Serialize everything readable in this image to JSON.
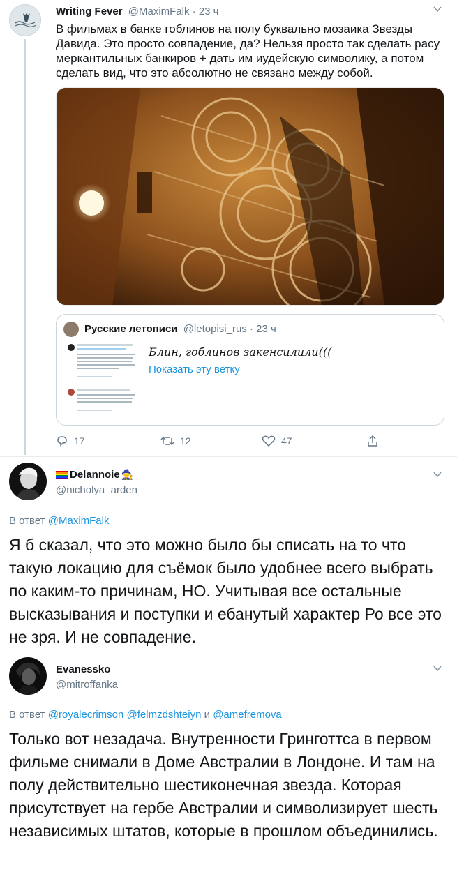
{
  "tweet1": {
    "name": "Writing Fever",
    "handle": "@MaximFalk",
    "time": "· 23 ч",
    "text": "В фильмах в банке гоблинов на полу буквально мозаика Звезды Давида. Это просто совпадение, да? Нельзя просто так сделать расу меркантильных банкиров + дать им иудейскую символику, а потом сделать вид, что это абсолютно не связано между собой.",
    "quote": {
      "name": "Русские летописи",
      "handle": "@letopisi_rus",
      "time": "· 23 ч",
      "text": "Блин, гоблинов закенсилили(((",
      "show_thread": "Показать эту ветку"
    },
    "actions": {
      "replies": "17",
      "retweets": "12",
      "likes": "47"
    }
  },
  "tweet2": {
    "name": "Delannoie",
    "handle": "@nicholya_arden",
    "reply_prefix": "В ответ",
    "reply_to": "@MaximFalk",
    "text": "Я б сказал, что это можно было бы списать на то что такую локацию для съёмок было удобнее всего выбрать по каким-то причинам, НО. Учитывая все остальные высказывания и поступки и ебанутый характер Ро все это не зря. И не совпадение."
  },
  "tweet3": {
    "name": "Evanessko",
    "handle": "@mitroffanka",
    "reply_prefix": "В ответ",
    "reply_to_1": "@royalecrimson",
    "reply_to_2": "@felmzdshteiyn",
    "reply_and": "и",
    "reply_to_3": "@amefremova",
    "text": "Только вот незадача. Внутренности Гринготтса в первом фильме снимали в Доме Австралии в Лондоне. И там на полу действительно шестиконечная звезда. Которая присутствует на гербе Австралии и символизирует шесть независимых штатов, которые в прошлом объединились."
  },
  "icons": [
    "chevron-down-icon",
    "reply-icon",
    "retweet-icon",
    "like-icon",
    "share-icon",
    "rainbow-flag-icon",
    "wizard-emoji-icon"
  ]
}
